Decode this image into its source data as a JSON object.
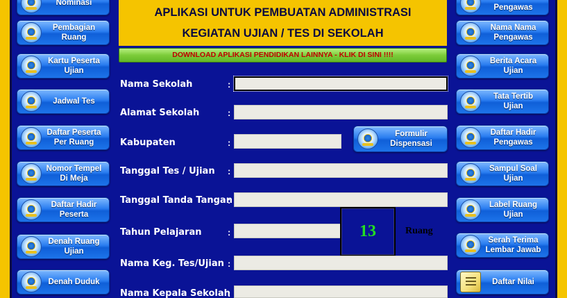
{
  "header": {
    "title_line1": "APLIKASI UNTUK PEMBUATAN ADMINISTRASI",
    "title_line2": "KEGIATAN UJIAN / TES DI SEKOLAH",
    "download_link": "DOWNLOAD APLIKASI PENDIDIKAN  LAINNYA - KLIK DI SINI !!!!"
  },
  "left_buttons": [
    {
      "line1": "Nominasi",
      "line2": ""
    },
    {
      "line1": "Pembagian",
      "line2": "Ruang"
    },
    {
      "line1": "Kartu Peserta",
      "line2": "Ujian"
    },
    {
      "line1": "Jadwal Tes",
      "line2": ""
    },
    {
      "line1": "Daftar Peserta",
      "line2": "Per Ruang"
    },
    {
      "line1": "Nomor Tempel",
      "line2": "Di Meja"
    },
    {
      "line1": "Daftar Hadir",
      "line2": "Peserta"
    },
    {
      "line1": "Denah Ruang",
      "line2": "Ujian"
    },
    {
      "line1": "Denah Duduk",
      "line2": ""
    }
  ],
  "right_buttons": [
    {
      "line1": "Pengawas",
      "line2": ""
    },
    {
      "line1": "Nama Nama",
      "line2": "Pengawas"
    },
    {
      "line1": "Berita Acara",
      "line2": "Ujian"
    },
    {
      "line1": "Tata Tertib",
      "line2": "Ujian"
    },
    {
      "line1": "Daftar Hadir",
      "line2": "Pengawas"
    },
    {
      "line1": "Sampul Soal",
      "line2": "Ujian"
    },
    {
      "line1": "Label Ruang",
      "line2": "Ujian"
    },
    {
      "line1": "Serah Terima",
      "line2": "Lembar Jawab"
    },
    {
      "line1": "Daftar Nilai",
      "line2": ""
    }
  ],
  "formulir_button": {
    "line1": "Formulir",
    "line2": "Dispensasi"
  },
  "form": {
    "colon": ":",
    "fields": [
      {
        "label": "Nama Sekolah",
        "value": ""
      },
      {
        "label": "Alamat Sekolah",
        "value": ""
      },
      {
        "label": "Kabupaten",
        "value": ""
      },
      {
        "label": "Tanggal Tes / Ujian",
        "value": ""
      },
      {
        "label": "Tanggal Tanda Tangan",
        "value": ""
      },
      {
        "label": "Tahun Pelajaran",
        "value": ""
      },
      {
        "label": "Nama Keg. Tes/Ujian",
        "value": ""
      },
      {
        "label": "Nama Kepala Sekolah",
        "value": ""
      }
    ]
  },
  "room_counter": {
    "value": "13",
    "unit": "Ruang",
    "value_color": "#22dd22"
  },
  "colors": {
    "panel": "#0a1396",
    "frame": "#f5c400",
    "download_text": "#c00000"
  }
}
